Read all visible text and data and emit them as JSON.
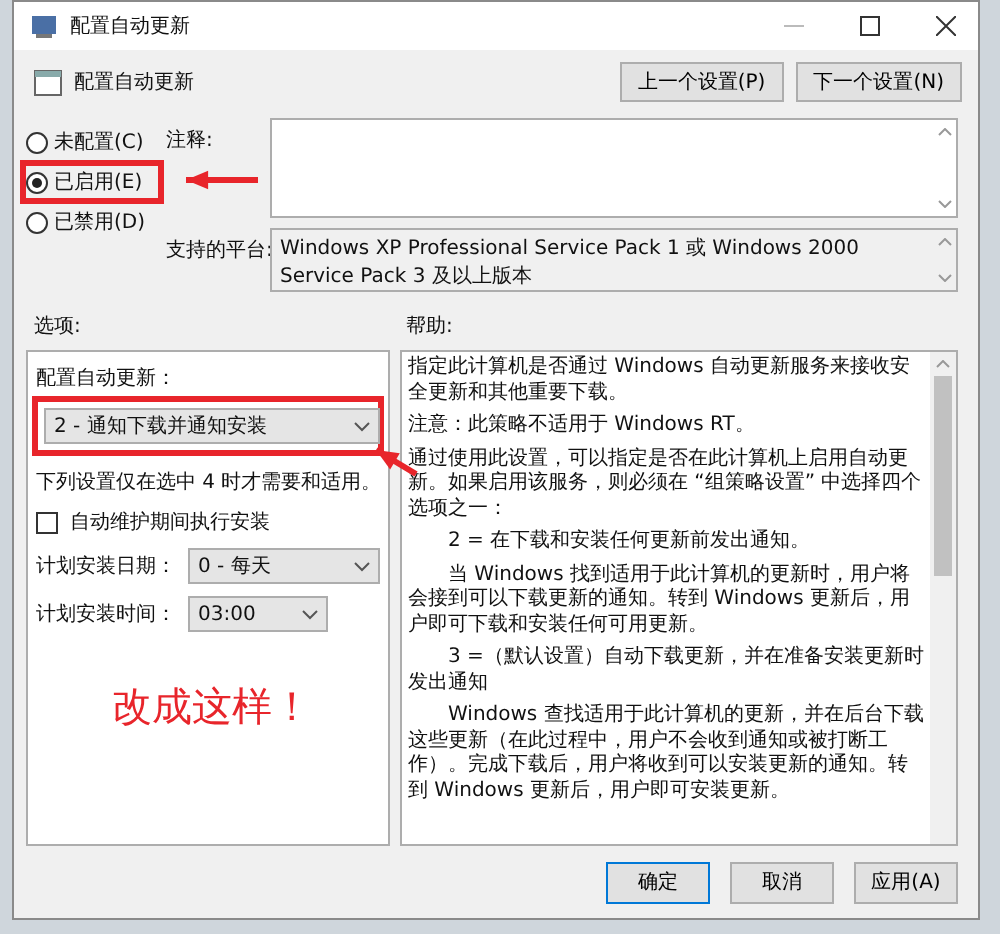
{
  "window": {
    "title": "配置自动更新"
  },
  "header": {
    "title": "配置自动更新",
    "buttons": [
      "上一个设置(P)",
      "下一个设置(N)"
    ]
  },
  "state_options": [
    {
      "label": "未配置(C)",
      "selected": false,
      "highlighted": false
    },
    {
      "label": "已启用(E)",
      "selected": true,
      "highlighted": true
    },
    {
      "label": "已禁用(D)",
      "selected": false,
      "highlighted": false
    }
  ],
  "comment": {
    "label": "注释:"
  },
  "platform": {
    "label": "支持的平台:",
    "value": "Windows XP Professional Service Pack 1 或 Windows 2000 Service Pack 3 及以上版本"
  },
  "options": {
    "label": "选项:",
    "configure_label": "配置自动更新：",
    "configure_value": "2 - 通知下载并通知安装",
    "configure_highlighted": true,
    "note": "下列设置仅在选中 4 时才需要和适用。",
    "maintenance": {
      "label": "自动维护期间执行安装",
      "checked": false
    },
    "fields": [
      {
        "label": "计划安装日期：",
        "value": "0 - 每天"
      },
      {
        "label": "计划安装时间：",
        "value": "03:00"
      }
    ]
  },
  "help": {
    "label": "帮助:",
    "paragraphs": [
      {
        "kind": "plain",
        "text": "指定此计算机是否通过 Windows 自动更新服务来接收安全更新和其他重要下载。"
      },
      {
        "kind": "plain",
        "text": "注意：此策略不适用于 Windows RT。"
      },
      {
        "kind": "plain",
        "text": "通过使用此设置，可以指定是否在此计算机上启用自动更新。如果启用该服务，则必须在 “组策略设置” 中选择四个选项之一："
      },
      {
        "kind": "indent",
        "text": "2 = 在下载和安装任何更新前发出通知。"
      },
      {
        "kind": "indent",
        "text": "当 Windows 找到适用于此计算机的更新时，用户将会接到可以下载更新的通知。转到 Windows 更新后，用户即可下载和安装任何可用更新。"
      },
      {
        "kind": "indent",
        "text": "3 =（默认设置）自动下载更新，并在准备安装更新时发出通知"
      },
      {
        "kind": "indent",
        "text": "Windows 查找适用于此计算机的更新，并在后台下载这些更新（在此过程中，用户不会收到通知或被打断工作）。完成下载后，用户将收到可以安装更新的通知。转到 Windows 更新后，用户即可安装更新。"
      }
    ]
  },
  "buttons": [
    "确定",
    "取消",
    "应用(A)"
  ],
  "annotation": {
    "text": "改成这样！"
  }
}
